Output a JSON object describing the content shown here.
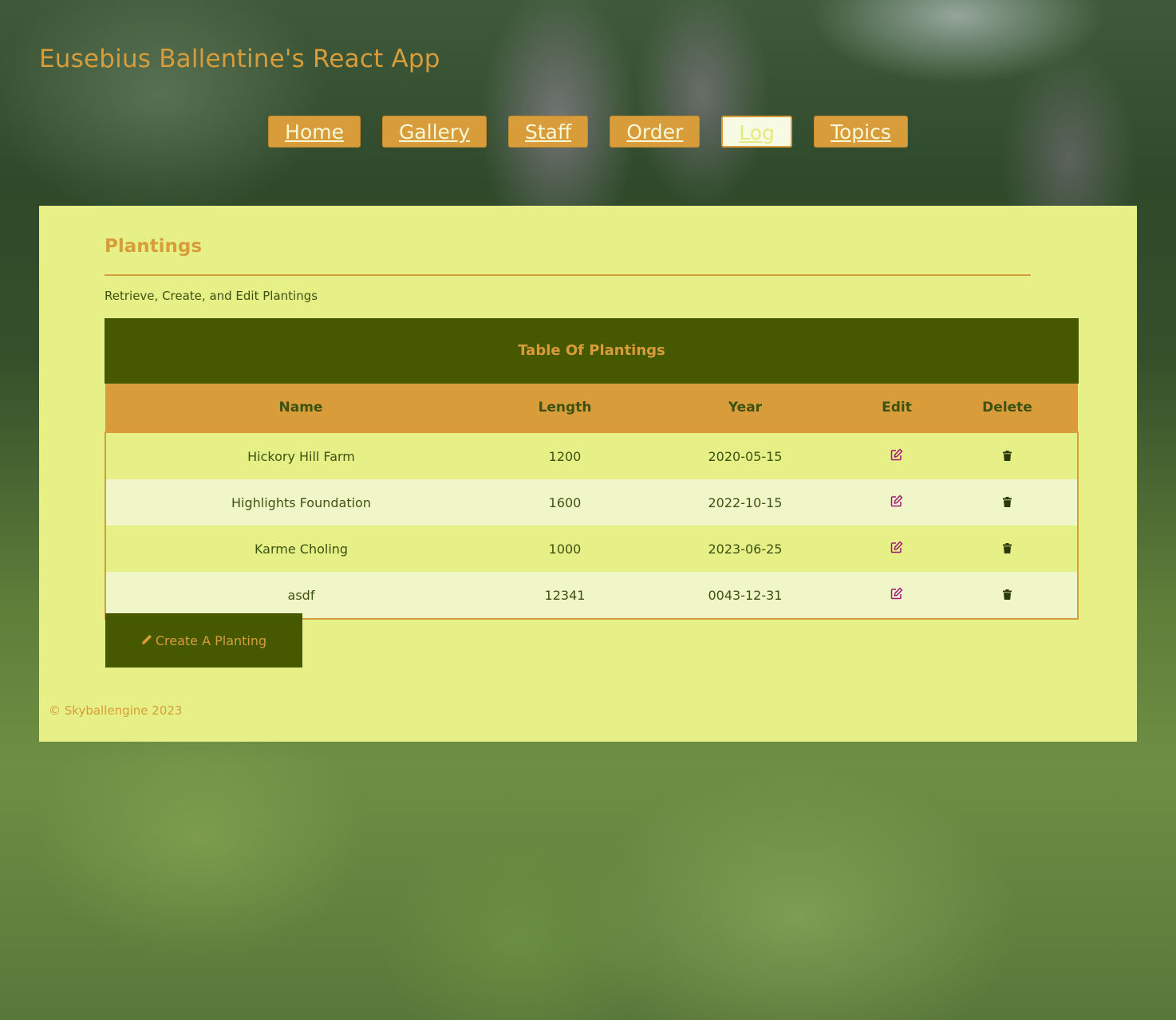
{
  "app": {
    "title": "Eusebius Ballentine's React App"
  },
  "nav": {
    "items": [
      {
        "label": "Home"
      },
      {
        "label": "Gallery"
      },
      {
        "label": "Staff"
      },
      {
        "label": "Order"
      },
      {
        "label": "Log",
        "active": true
      },
      {
        "label": "Topics"
      }
    ]
  },
  "page": {
    "heading": "Plantings",
    "subtitle": "Retrieve, Create, and Edit Plantings"
  },
  "table": {
    "caption": "Table Of Plantings",
    "headers": [
      "Name",
      "Length",
      "Year",
      "Edit",
      "Delete"
    ],
    "rows": [
      {
        "name": "Hickory Hill Farm",
        "length": "1200",
        "year": "2020-05-15"
      },
      {
        "name": "Highlights Foundation",
        "length": "1600",
        "year": "2022-10-15"
      },
      {
        "name": "Karme Choling",
        "length": "1000",
        "year": "2023-06-25"
      },
      {
        "name": "asdf",
        "length": "12341",
        "year": "0043-12-31"
      }
    ],
    "row_icons": {
      "edit": "edit-icon",
      "delete": "trash-icon"
    }
  },
  "create_button": {
    "label": "Create A Planting",
    "icon": "pencil-icon"
  },
  "footer": {
    "text": "© Skyballengine 2023"
  },
  "colors": {
    "accent": "#d89c3a",
    "panel": "#e6f086",
    "dark_green": "#465800",
    "row_alt": "#f1f6c8",
    "edit_icon": "#a0197a"
  }
}
